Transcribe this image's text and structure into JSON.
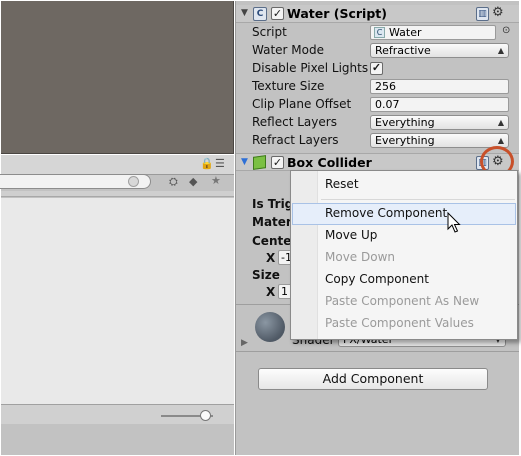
{
  "inspector": {
    "water_script": {
      "title": "Water (Script)",
      "enabled": true,
      "properties": [
        {
          "label": "Script",
          "value": "Water",
          "kind": "object"
        },
        {
          "label": "Water Mode",
          "value": "Refractive",
          "kind": "popup"
        },
        {
          "label": "Disable Pixel Lights",
          "value": true,
          "kind": "checkbox"
        },
        {
          "label": "Texture Size",
          "value": "256",
          "kind": "field"
        },
        {
          "label": "Clip Plane Offset",
          "value": "0.07",
          "kind": "field"
        },
        {
          "label": "Reflect Layers",
          "value": "Everything",
          "kind": "popup"
        },
        {
          "label": "Refract Layers",
          "value": "Everything",
          "kind": "popup"
        }
      ]
    },
    "box_collider": {
      "title": "Box Collider",
      "enabled": true,
      "partial_labels": [
        "Is Trig",
        "Mater",
        "Cente",
        "Size"
      ],
      "axis_x_label": "X",
      "center_x_partial": "-1",
      "size_x_partial": "1"
    },
    "material": {
      "shader_label": "Shader",
      "shader_value": "FX/Water"
    },
    "add_component_label": "Add Component"
  },
  "context_menu": {
    "items": [
      {
        "label": "Reset",
        "enabled": true,
        "hovered": false
      },
      {
        "label": "Remove Component",
        "enabled": true,
        "hovered": true
      },
      {
        "label": "Move Up",
        "enabled": true,
        "hovered": false
      },
      {
        "label": "Move Down",
        "enabled": false,
        "hovered": false
      },
      {
        "label": "Copy Component",
        "enabled": true,
        "hovered": false
      },
      {
        "label": "Paste Component As New",
        "enabled": false,
        "hovered": false
      },
      {
        "label": "Paste Component Values",
        "enabled": false,
        "hovered": false
      }
    ]
  },
  "colors": {
    "highlight_ring": "#c8502a",
    "menu_hover": "#e6eefa",
    "scene_background": "#6e6862",
    "panel_background": "#c2c2c2"
  },
  "icons": {
    "script_component": "script-icon",
    "collider_component": "green-cube-icon",
    "settings": "gear-icon",
    "help": "book-icon",
    "lock": "lock-icon",
    "star": "star-icon",
    "cursor": "mouse-pointer-icon"
  }
}
